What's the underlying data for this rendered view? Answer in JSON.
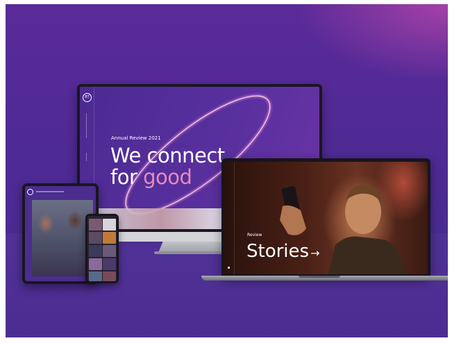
{
  "imac": {
    "logo": "BT",
    "kicker": "Annual Review 2021",
    "headline_line1": "We connect",
    "headline_line2_prefix": "for ",
    "headline_line2_accent": "good",
    "accent_color": "#e48ac0"
  },
  "laptop": {
    "kicker": "Review",
    "headline": "Stories",
    "arrow": "→"
  },
  "colors": {
    "background": "#4e2a94",
    "highlight": "#b246aa"
  }
}
